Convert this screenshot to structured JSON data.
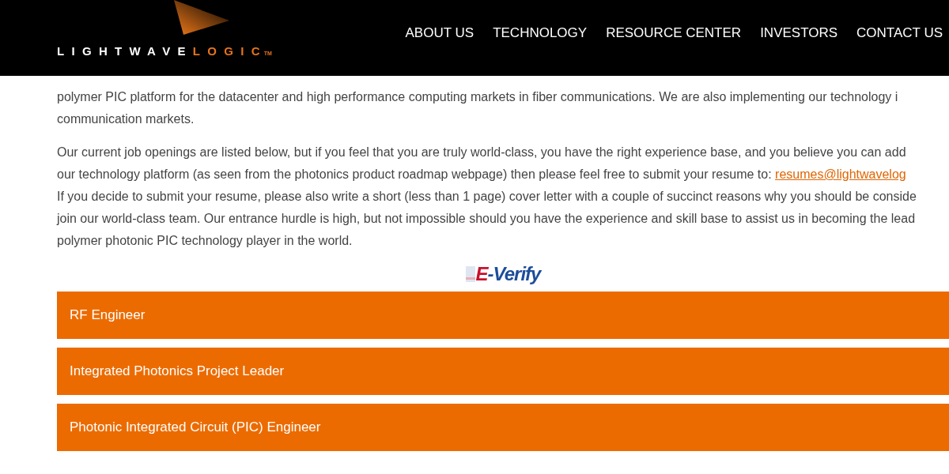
{
  "header": {
    "logo": {
      "part_1": "LIGHTWAVE",
      "part_2": "LOGIC",
      "mark": "TM"
    },
    "nav": [
      {
        "label": "ABOUT US"
      },
      {
        "label": "TECHNOLOGY"
      },
      {
        "label": "RESOURCE CENTER"
      },
      {
        "label": "INVESTORS"
      },
      {
        "label": "CONTACT US"
      }
    ]
  },
  "paragraphs": [
    {
      "lines": [
        {
          "text": "polymer PIC platform for the datacenter and high performance computing markets in fiber communications. We are also implementing our technology i"
        },
        {
          "text": "communication markets."
        }
      ]
    },
    {
      "lines": [
        {
          "text": "Our current job openings are listed below, but if you feel that you are truly world-class, you have the right experience base, and you believe you can add"
        },
        {
          "text": "our technology platform (as seen from the photonics product roadmap webpage) then please feel free to submit your resume to: ",
          "link": "resumes@lightwavelog"
        },
        {
          "text": "If you decide to submit your resume, please also write a short (less than 1 page) cover letter with a couple of succinct reasons why you should be conside"
        },
        {
          "text": "join our world-class team. Our entrance hurdle is high, but not impossible should you have the experience and skill base to assist us in becoming the lead"
        },
        {
          "text": "polymer photonic PIC technology player in the world."
        }
      ]
    }
  ],
  "everify": {
    "part_1": "E",
    "part_2": "-Verify"
  },
  "jobs": [
    {
      "title": "RF Engineer",
      "expanded": false
    },
    {
      "title": "Integrated Photonics Project Leader",
      "expanded": false
    },
    {
      "title": "Photonic Integrated Circuit (PIC) Engineer",
      "expanded": false
    }
  ]
}
